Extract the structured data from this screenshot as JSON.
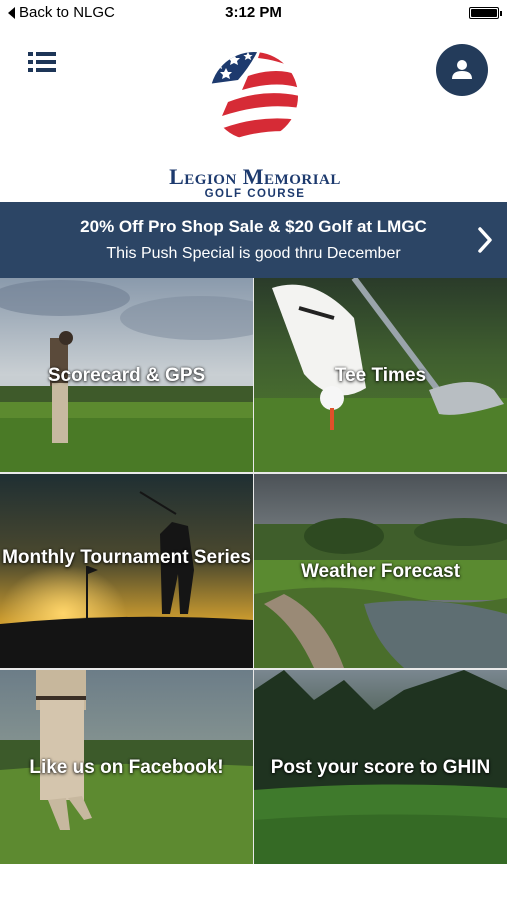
{
  "status_bar": {
    "back_label": "Back to NLGC",
    "time": "3:12 PM",
    "battery_level": 1.0
  },
  "header": {
    "menu_icon": "hamburger-list-icon",
    "profile_icon": "user-icon",
    "logo": {
      "title": "Legion Memorial",
      "subtitle": "GOLF COURSE",
      "colors": {
        "blue": "#1d3a6e",
        "red": "#d62b36"
      }
    }
  },
  "promo": {
    "title": "20% Off Pro Shop Sale & $20 Golf at LMGC",
    "subtitle": "This Push Special is good thru December",
    "chevron_icon": "chevron-right-icon",
    "background": "#2c4565"
  },
  "tiles": [
    {
      "label": "Scorecard & GPS"
    },
    {
      "label": "Tee Times"
    },
    {
      "label": "Monthly Tournament Series"
    },
    {
      "label": "Weather Forecast"
    },
    {
      "label": "Like us on Facebook!"
    },
    {
      "label": "Post your score to GHIN"
    }
  ]
}
